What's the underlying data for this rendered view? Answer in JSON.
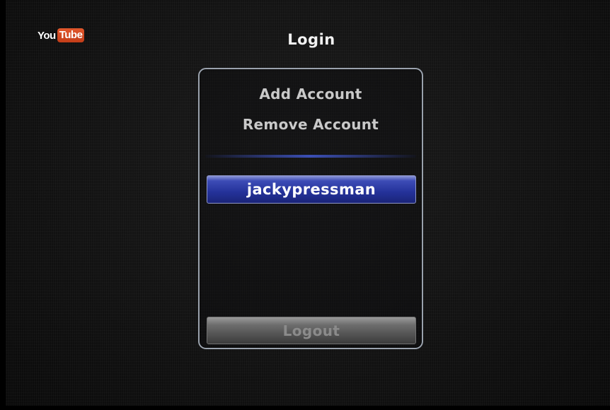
{
  "logo": {
    "part1": "You",
    "part2": "Tube"
  },
  "header": {
    "title": "Login"
  },
  "menu": {
    "add_account_label": "Add Account",
    "remove_account_label": "Remove Account"
  },
  "accounts": [
    {
      "username": "jackypressman",
      "selected": true
    }
  ],
  "footer": {
    "logout_label": "Logout"
  },
  "colors": {
    "background": "#121212",
    "panel_border": "#9aa2ad",
    "selection": "#2a3aa5",
    "logo_tube": "#d24a22",
    "menu_text": "#c9c9c9",
    "disabled_text": "#8b8b8b"
  }
}
